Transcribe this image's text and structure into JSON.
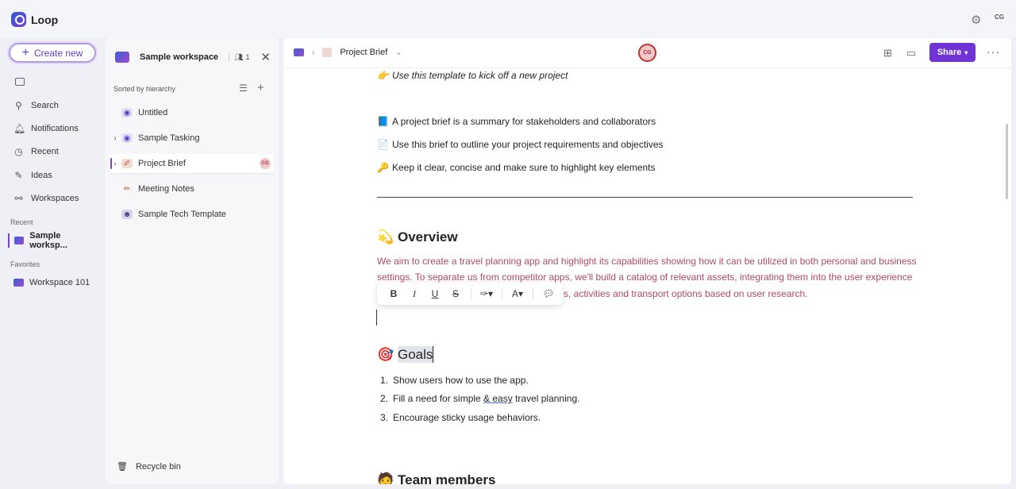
{
  "app": {
    "name": "Loop",
    "user_initials": "CG"
  },
  "nav": {
    "create_label": "Create new",
    "items": [
      {
        "label": "Search",
        "icon": "search-icon"
      },
      {
        "label": "Notifications",
        "icon": "bell-icon"
      },
      {
        "label": "Recent",
        "icon": "clock-icon"
      },
      {
        "label": "Ideas",
        "icon": "ideas-icon"
      },
      {
        "label": "Workspaces",
        "icon": "workspaces-icon"
      }
    ],
    "recent_heading": "Recent",
    "recent_item": "Sample worksp...",
    "favorites_heading": "Favorites",
    "favorite_item": "Workspace 101"
  },
  "workspace": {
    "name": "Sample workspace",
    "member_count": "1",
    "sort_label": "Sorted by hierarchy",
    "pages": [
      {
        "label": "Untitled",
        "icon": "loop-page-icon",
        "expandable": false
      },
      {
        "label": "Sample Tasking",
        "icon": "loop-page-icon",
        "expandable": true
      },
      {
        "label": "Project Brief",
        "icon": "brief-icon",
        "expandable": true,
        "active": true,
        "avatar": "CG"
      },
      {
        "label": "Meeting Notes",
        "icon": "pencil-icon",
        "expandable": false
      },
      {
        "label": "Sample Tech Template",
        "icon": "robot-icon",
        "expandable": false
      }
    ],
    "recycle_label": "Recycle bin"
  },
  "header": {
    "page_title": "Project Brief",
    "collaborator_initials": "CG",
    "share_label": "Share"
  },
  "doc": {
    "intro": "Use this template to kick off a new project",
    "bullets": [
      "A project brief is a summary for stakeholders and collaborators",
      "Use this brief to outline your project requirements and objectives",
      "Keep it clear, concise and make sure to highlight key elements"
    ],
    "overview_heading": "Overview",
    "overview_line1": "We aim to create a travel planning app and highlight its capabilities showing how it can be utilized in both personal and business",
    "overview_line2": "settings. To separate us from competitor apps, we'll build a catalog of relevant assets, integrating them into the user experience",
    "overview_line3_start": "f",
    "overview_line3_end": "s, activities and transport options based on user research.",
    "goals_heading": "Goals",
    "goals": [
      {
        "num": "1.",
        "text": "Show users how to use the app."
      },
      {
        "num": "2.",
        "pre": "Fill a need for simple ",
        "underlined": "& easy",
        "post": " travel planning."
      },
      {
        "num": "3.",
        "text": "Encourage sticky usage behaviors."
      }
    ],
    "team_heading": "Team members"
  },
  "toolbar": {
    "bold": "B",
    "italic": "I",
    "underline": "U",
    "strike": "S"
  }
}
